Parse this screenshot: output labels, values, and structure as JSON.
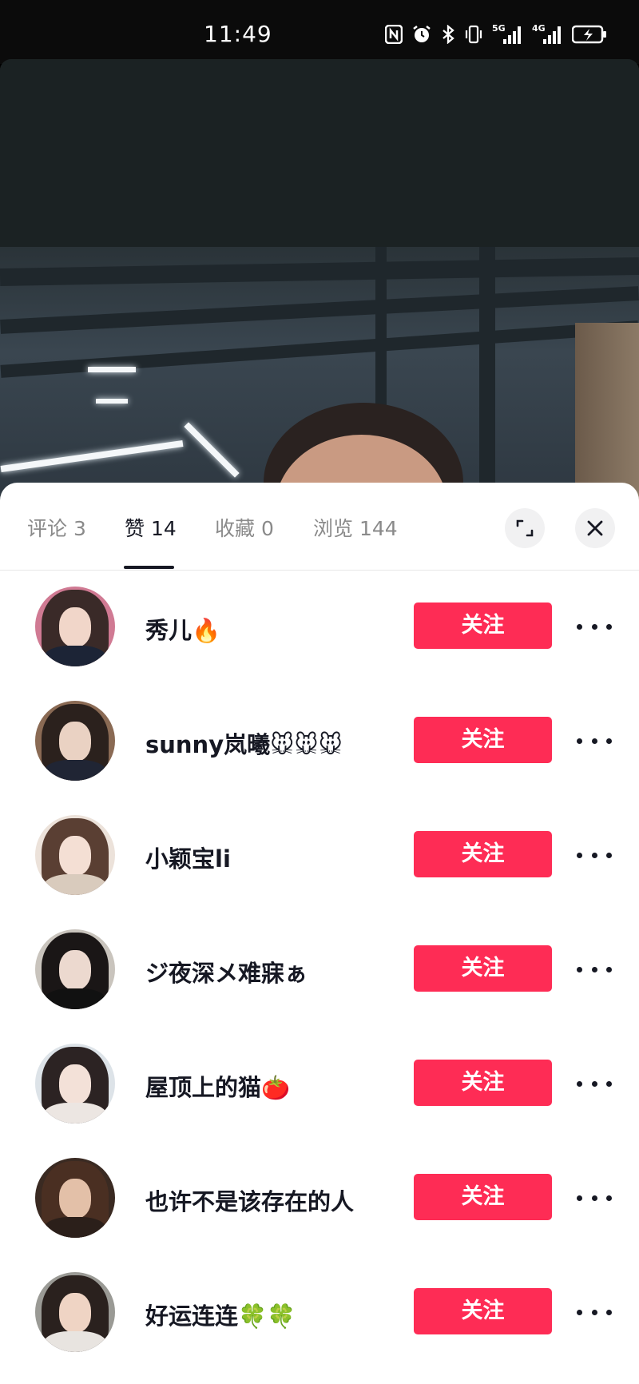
{
  "status_bar": {
    "time": "11:49",
    "icons": [
      "nfc-icon",
      "alarm-icon",
      "bluetooth-icon",
      "vibrate-icon",
      "signal-5g-icon",
      "signal-4g-icon",
      "battery-charging-icon"
    ],
    "net1": "5G",
    "net2": "4G"
  },
  "tabs": [
    {
      "label": "评论 3",
      "active": false
    },
    {
      "label": "赞 14",
      "active": true
    },
    {
      "label": "收藏 0",
      "active": false
    },
    {
      "label": "浏览 144",
      "active": false
    }
  ],
  "header_actions": {
    "expand_icon": "expand-icon",
    "close_icon": "close-icon"
  },
  "users": [
    {
      "name": "秀儿🔥",
      "follow_label": "关注"
    },
    {
      "name": "sunny岚曦🐭🐭🐭",
      "follow_label": "关注"
    },
    {
      "name": "小颖宝li",
      "follow_label": "关注"
    },
    {
      "name": "ジ夜深メ难寐ぁ",
      "follow_label": "关注"
    },
    {
      "name": "屋顶上的猫🍅",
      "follow_label": "关注"
    },
    {
      "name": "也许不是该存在的人",
      "follow_label": "关注"
    },
    {
      "name": "好运连连🍀🍀",
      "follow_label": "关注"
    }
  ],
  "colors": {
    "accent": "#fe2c55",
    "text_primary": "#161823",
    "text_secondary": "#8a8a8a"
  }
}
